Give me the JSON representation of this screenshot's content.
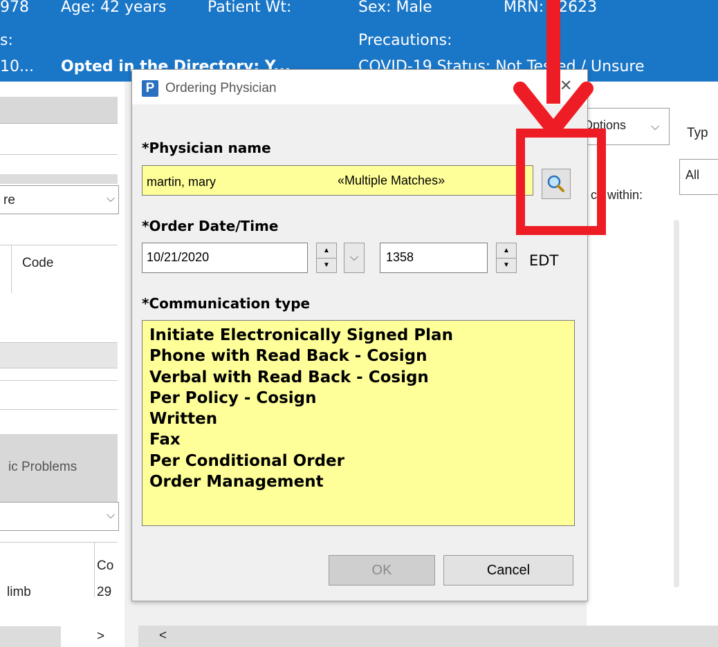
{
  "banner": {
    "row1": [
      "978",
      "Age: 42 years",
      "Patient Wt:",
      "Sex: Male",
      "MRN: 12623"
    ],
    "row2_left": "s:",
    "row2_precautions": "Precautions:",
    "row3_left": "10...",
    "row3_bold": "Opted in the Directory: Y...",
    "row3_covid": "COVID-19 Status: Not Tested / Unsure"
  },
  "background": {
    "left_combo_value": "re",
    "code_header": "Code",
    "problems_tab": "ic Problems",
    "table_row": "limb",
    "table_col": "Co",
    "table_col_value": "29",
    "options_label": "Options",
    "type_label": "Typ",
    "search_within_label": "ch within:",
    "search_within_value": "All",
    "scroll_left": "<",
    "scroll_right": ">"
  },
  "dialog": {
    "title": "Ordering Physician",
    "app_icon_letter": "P",
    "close": "✕",
    "physician_label": "*Physician name",
    "physician_value": "martin, mary",
    "physician_status": "«Multiple Matches»",
    "order_datetime_label": "*Order Date/Time",
    "order_date": "10/21/2020",
    "order_time": "1358",
    "timezone": "EDT",
    "communication_label": "*Communication type",
    "communication_options": [
      "Initiate Electronically Signed Plan",
      "Phone with Read Back - Cosign",
      "Verbal with Read Back - Cosign",
      "Per Policy - Cosign",
      "Written",
      "Fax",
      "Per Conditional Order",
      "Order Management"
    ],
    "ok_label": "OK",
    "cancel_label": "Cancel"
  },
  "icons": {
    "search": "magnifier-icon",
    "annotation": "red-arrow-icon"
  },
  "colors": {
    "banner": "#1a76c7",
    "field_highlight": "#ffff99",
    "annotation": "#ee1c25"
  }
}
